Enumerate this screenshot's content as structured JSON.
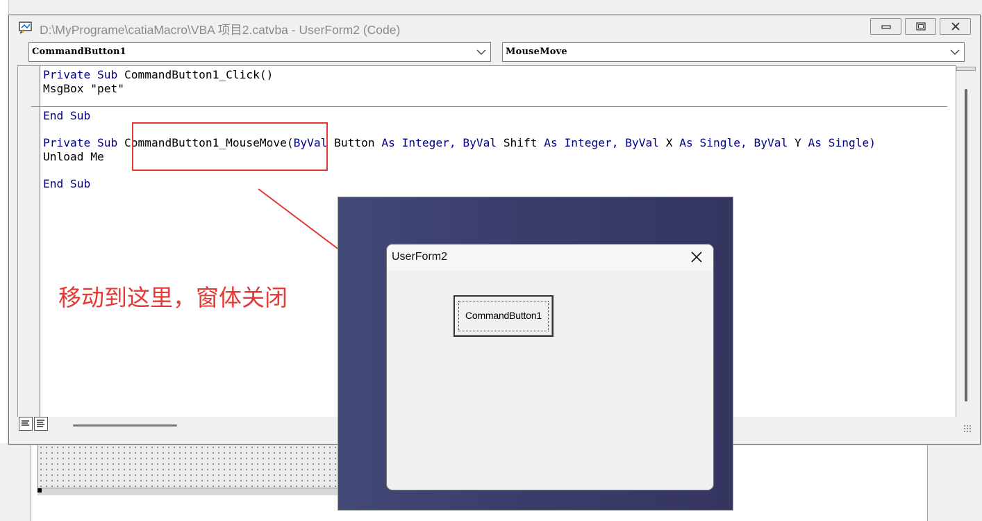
{
  "window": {
    "title": "D:\\MyPrograme\\catiaMacro\\VBA 项目2.catvba - UserForm2 (Code)",
    "object_combo": "CommandButton1",
    "procedure_combo": "MouseMove"
  },
  "code": {
    "proc1": {
      "kw_private": "Private",
      "kw_sub": "Sub",
      "name": "CommandButton1_Click()",
      "body": "MsgBox \"pet\"",
      "end": "End Sub"
    },
    "proc2": {
      "kw_private": "Private",
      "kw_sub": "Sub",
      "name": "CommandButton1_MouseMove(",
      "byval1": "ByVal",
      "p1": "Button",
      "as1": "As",
      "t1": "Integer,",
      "byval2": "ByVal",
      "p2": "Shift",
      "as2": "As",
      "t2": "Integer,",
      "byval3": "ByVal",
      "p3": "X",
      "as3": "As",
      "t3": "Single,",
      "byval4": "ByVal",
      "p4": "Y",
      "as4": "As",
      "t4": "Single)",
      "body": "Unload Me",
      "end": "End Sub"
    }
  },
  "annotation": "移动到这里，窗体关闭",
  "userform": {
    "title": "UserForm2",
    "button_label": "CommandButton1"
  },
  "colors": {
    "keyword": "#00008b",
    "annotation": "#e53935",
    "backdrop": "#3b3e6c"
  }
}
